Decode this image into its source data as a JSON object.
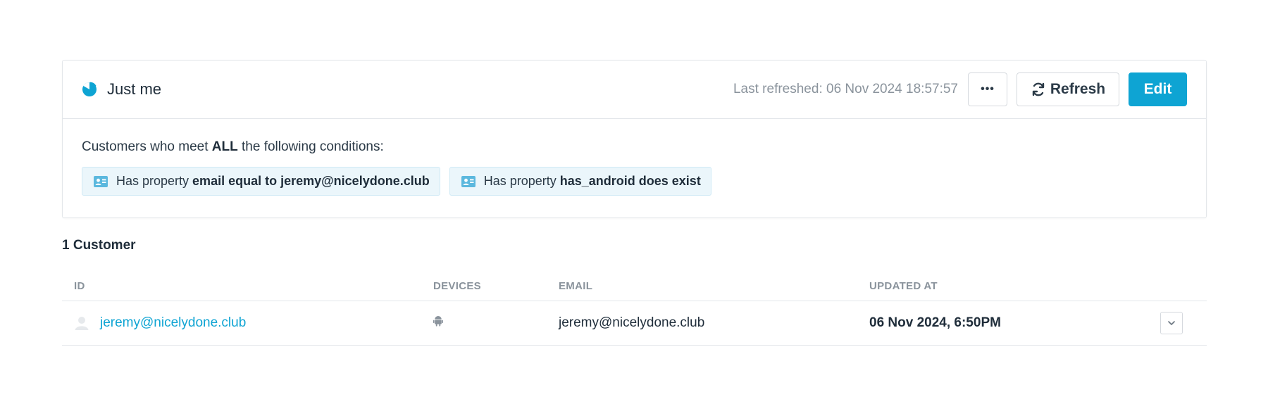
{
  "segment": {
    "title": "Just me",
    "icon": "pie-chart-icon",
    "last_refreshed": "Last refreshed: 06 Nov 2024 18:57:57",
    "more_label": "•••",
    "refresh_label": "Refresh",
    "edit_label": "Edit",
    "accent_color": "#0ea4d3"
  },
  "conditions": {
    "intro_prefix": "Customers who meet",
    "intro_bold": "ALL",
    "intro_suffix": "the following conditions:",
    "chips": [
      {
        "icon": "contact-card-icon",
        "prefix": "Has property",
        "detail": "email equal to jeremy@nicelydone.club"
      },
      {
        "icon": "contact-card-icon",
        "prefix": "Has property",
        "detail": "has_android does exist"
      }
    ]
  },
  "results": {
    "count_label": "1 Customer",
    "columns": {
      "id": "ID",
      "devices": "DEVICES",
      "email": "EMAIL",
      "updated_at": "UPDATED AT"
    },
    "rows": [
      {
        "id": "jeremy@nicelydone.club",
        "device_icon": "android-icon",
        "email": "jeremy@nicelydone.club",
        "updated_at": "06 Nov 2024, 6:50PM"
      }
    ]
  }
}
